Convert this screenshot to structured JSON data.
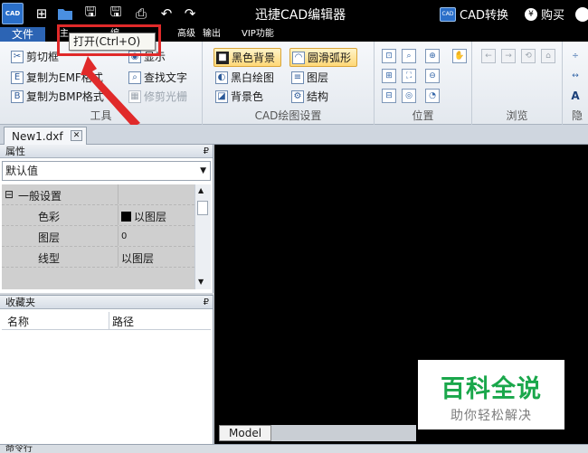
{
  "window": {
    "title": "迅捷CAD编辑器",
    "convert_label": "CAD转换",
    "buy_label": "购买",
    "logo_text": "CAD",
    "convert_badge": "CAD"
  },
  "menu": {
    "file": "文件",
    "hidden_a": "主",
    "hidden_b": "编",
    "advanced": "高级",
    "output": "输出",
    "vip": "VIP功能"
  },
  "tooltip": "打开(Ctrl+O)",
  "ribbon": {
    "tools": {
      "label": "工具",
      "items": [
        "剪切框",
        "复制为EMF格式",
        "复制为BMP格式",
        "显示",
        "查找文字",
        "修剪光栅"
      ]
    },
    "settings": {
      "label": "CAD绘图设置",
      "items": [
        "黑色背景",
        "黑白绘图",
        "背景色",
        "圆滑弧形",
        "图层",
        "结构"
      ]
    },
    "position": {
      "label": "位置"
    },
    "browse": {
      "label": "浏览"
    },
    "hidden": {
      "label": "隐"
    }
  },
  "document_tab": "New1.dxf",
  "properties": {
    "title": "属性",
    "dropdown": "默认值",
    "section": "一般设置",
    "rows": [
      {
        "name": "色彩",
        "value": "以图层"
      },
      {
        "name": "图层",
        "value": "0"
      },
      {
        "name": "线型",
        "value": "以图层"
      }
    ]
  },
  "favorites": {
    "title": "收藏夹",
    "col_name": "名称",
    "col_path": "路径"
  },
  "model_tab": "Model",
  "watermark": {
    "main": "百科全说",
    "sub": "助你轻松解决"
  },
  "command_bar": "命令行",
  "colors": {
    "title_bg": "#000000",
    "file_menu": "#2c64b4",
    "highlight_border": "#e02a2a",
    "watermark_green": "#1aa74b"
  }
}
